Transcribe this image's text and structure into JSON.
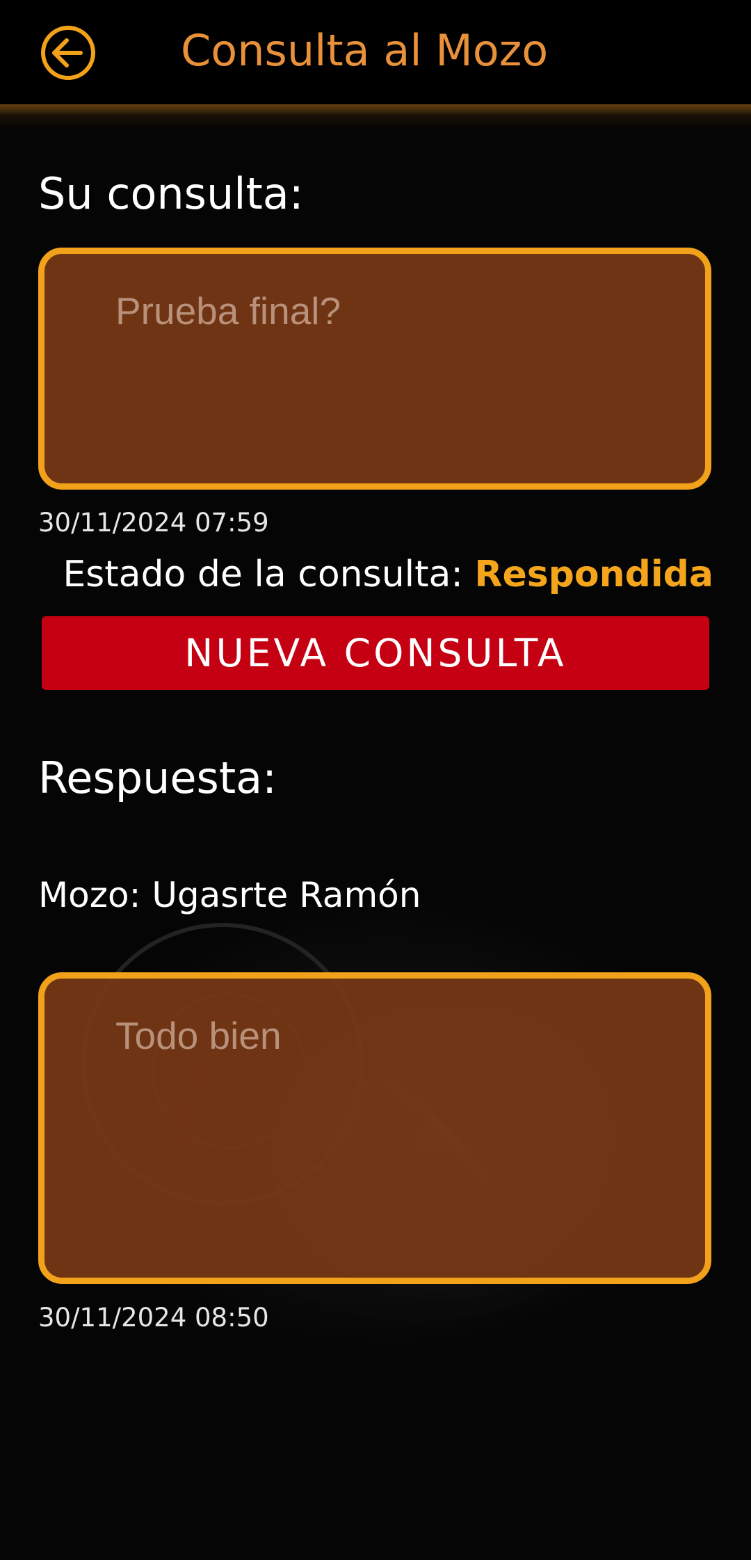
{
  "header": {
    "title": "Consulta al Mozo",
    "back_icon": "arrow-left-circle-icon"
  },
  "query": {
    "label": "Su consulta:",
    "text": "Prueba final?",
    "timestamp": "30/11/2024 07:59"
  },
  "status": {
    "label": "Estado de la consulta:",
    "value": "Respondida"
  },
  "new_query_button": {
    "label": "NUEVA CONSULTA"
  },
  "response": {
    "label": "Respuesta:",
    "waiter_prefix": "Mozo:",
    "waiter_name": "Ugasrte Ramón",
    "text": "Todo bien",
    "timestamp": "30/11/2024 08:50"
  },
  "colors": {
    "accent": "#F2A21A",
    "title": "#E8913A",
    "box_fill": "#783816",
    "button": "#C40012",
    "background": "#050505"
  }
}
